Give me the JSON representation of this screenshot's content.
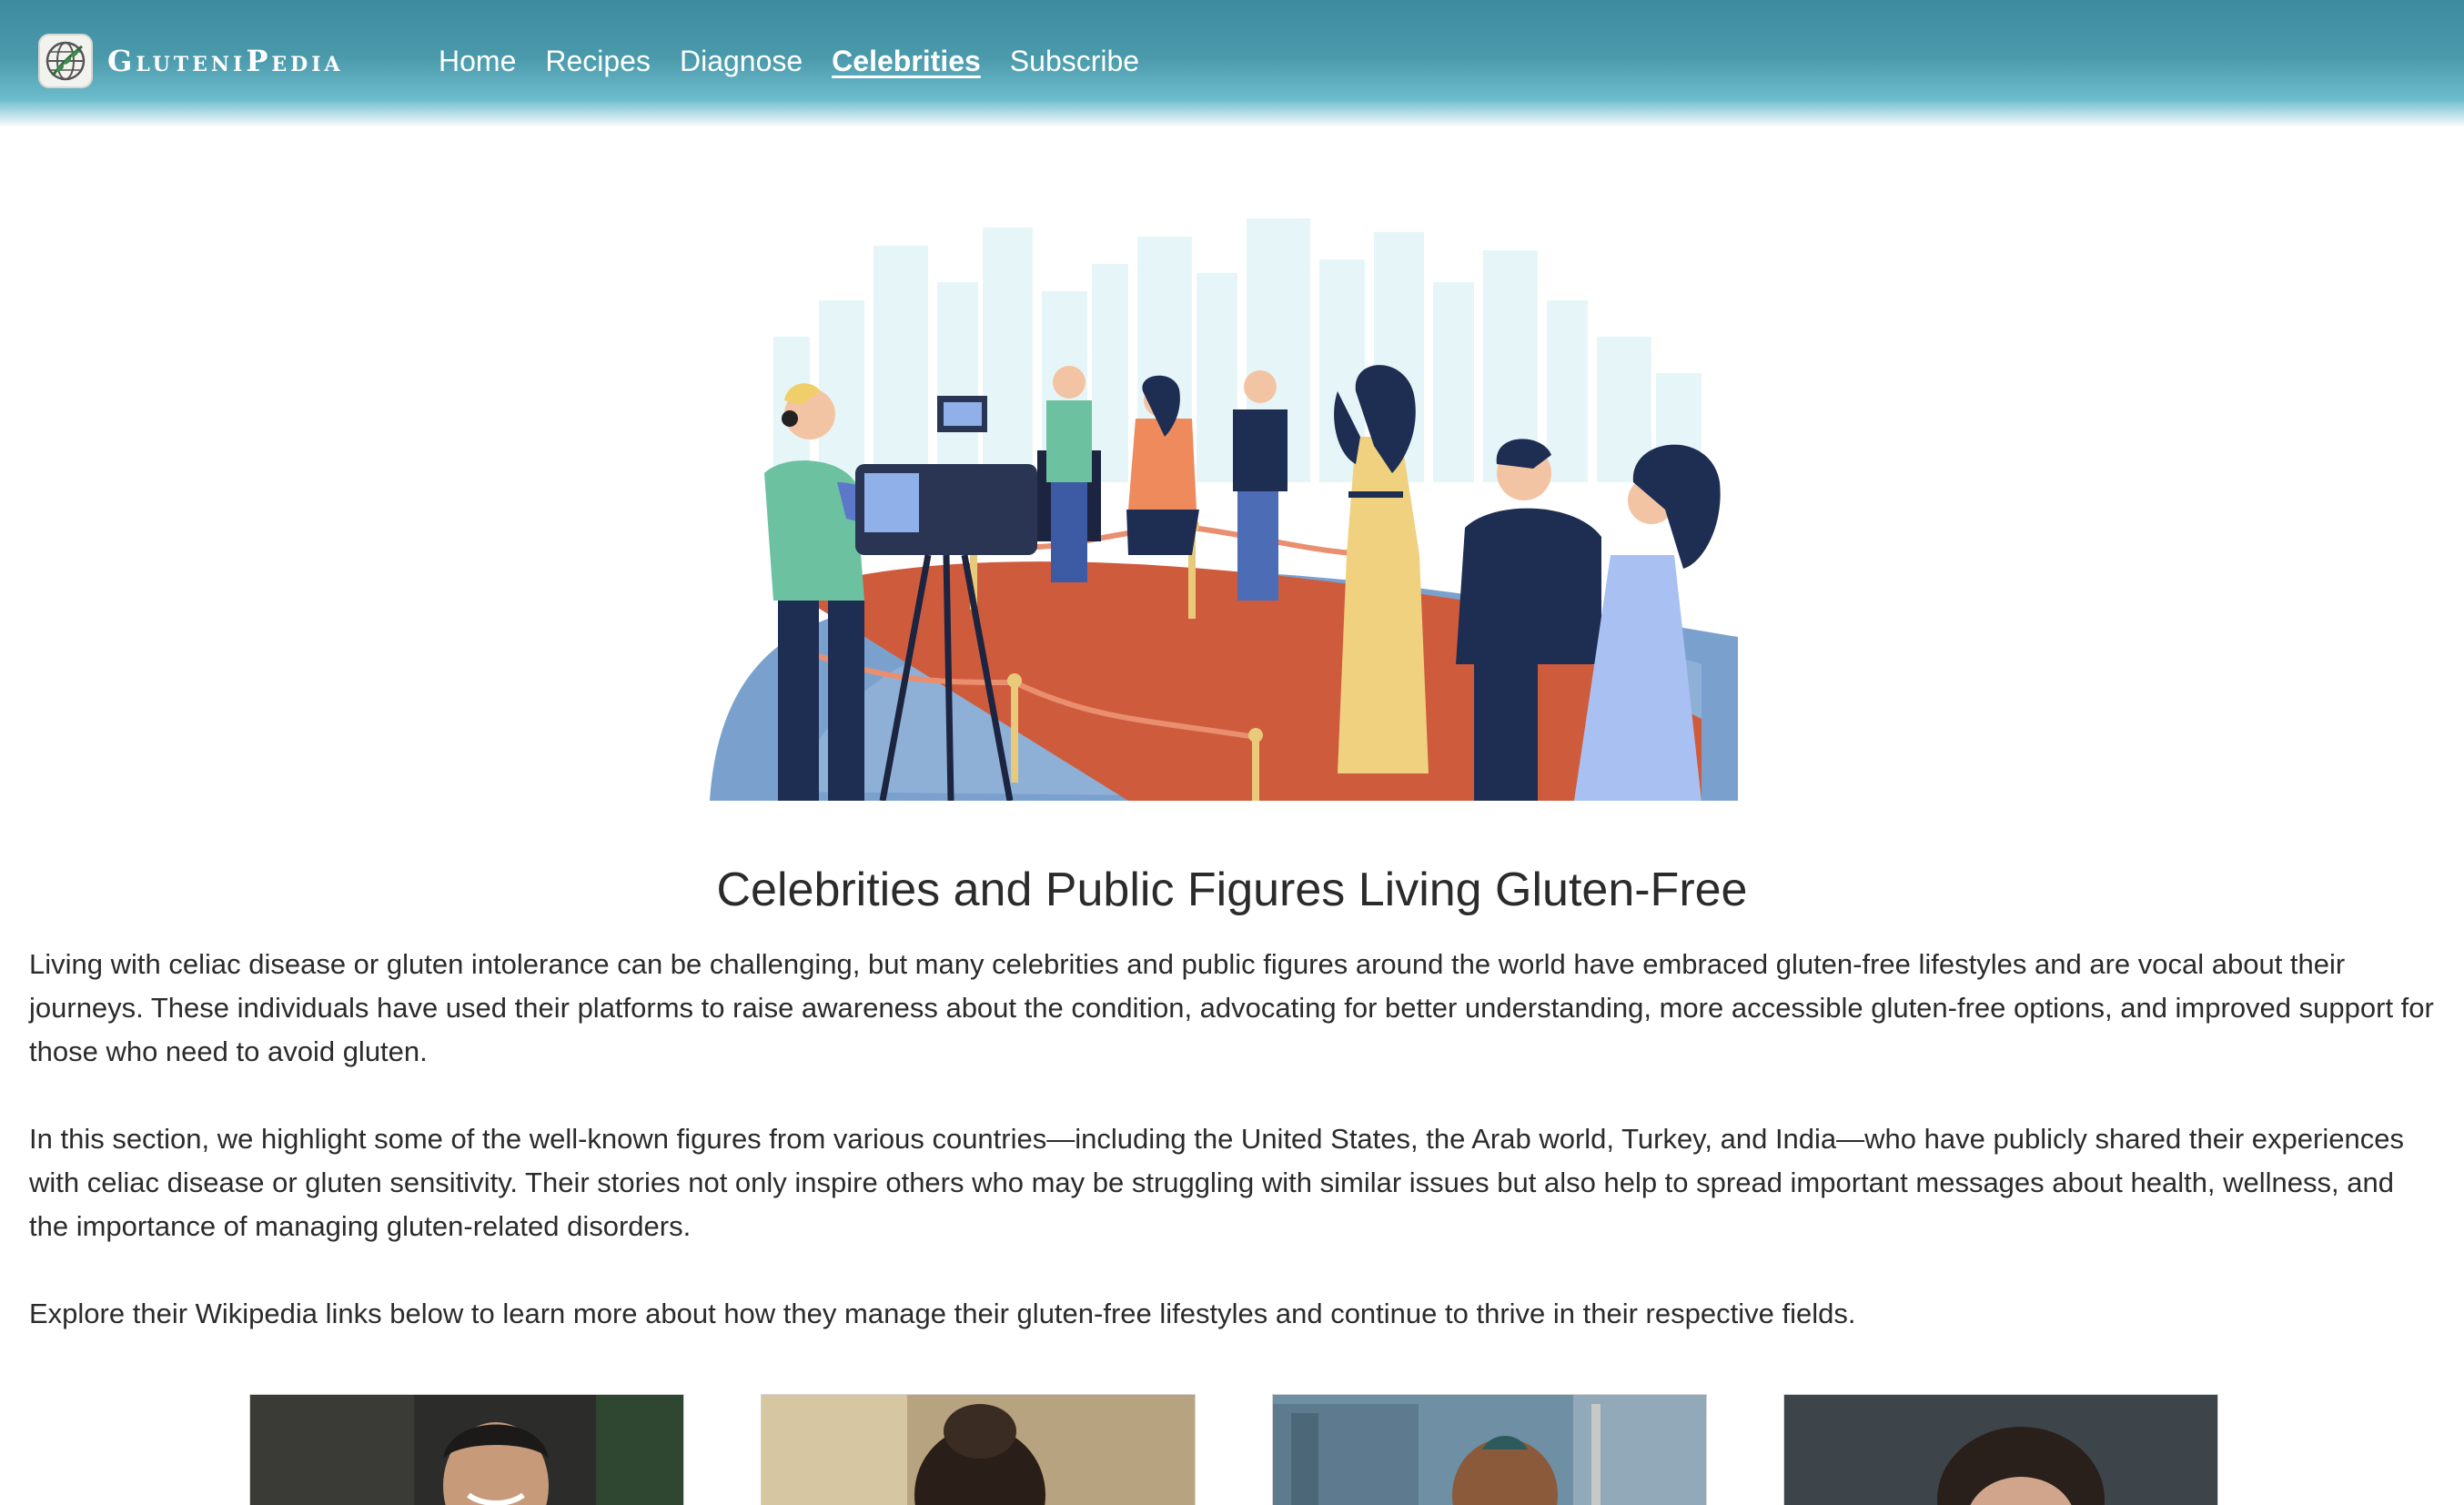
{
  "nav": {
    "brand": "GluteniPedia",
    "links": [
      {
        "label": "Home",
        "active": false
      },
      {
        "label": "Recipes",
        "active": false
      },
      {
        "label": "Diagnose",
        "active": false
      },
      {
        "label": "Celebrities",
        "active": true
      },
      {
        "label": "Subscribe",
        "active": false
      }
    ]
  },
  "main": {
    "title": "Celebrities and Public Figures Living Gluten-Free",
    "paragraphs": [
      "Living with celiac disease or gluten intolerance can be challenging, but many celebrities and public figures around the world have embraced gluten-free lifestyles and are vocal about their journeys. These individuals have used their platforms to raise awareness about the condition, advocating for better understanding, more accessible gluten-free options, and improved support for those who need to avoid gluten.",
      "In this section, we highlight some of the well-known figures from various countries—including the United States, the Arab world, Turkey, and India—who have publicly shared their experiences with celiac disease or gluten sensitivity. Their stories not only inspire others who may be struggling with similar issues but also help to spread important messages about health, wellness, and the importance of managing gluten-related disorders.",
      "Explore their Wikipedia links below to learn more about how they manage their gluten-free lifestyles and continue to thrive in their respective fields."
    ]
  },
  "colors": {
    "nav_bar": "#3d8b9f",
    "carpet": "#cf5b3d",
    "rope": "#e9c97a",
    "sky_buildings": "#e6f6f8"
  }
}
